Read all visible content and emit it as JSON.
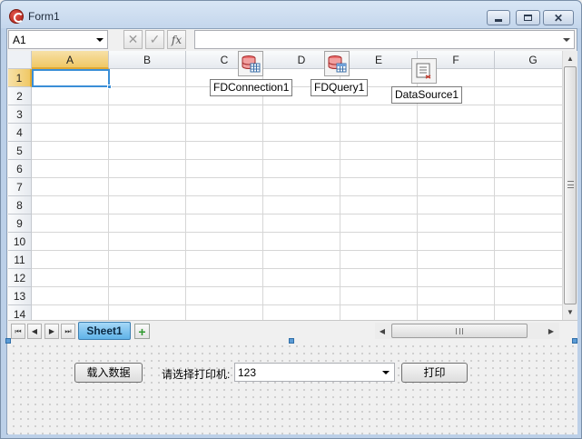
{
  "window": {
    "title": "Form1"
  },
  "formula_bar": {
    "cell_ref": "A1",
    "formula": ""
  },
  "grid": {
    "columns": [
      "A",
      "B",
      "C",
      "D",
      "E",
      "F",
      "G"
    ],
    "rows": [
      "1",
      "2",
      "3",
      "4",
      "5",
      "6",
      "7",
      "8",
      "9",
      "10",
      "11",
      "12",
      "13",
      "14"
    ],
    "active_column": "A",
    "active_row": "1"
  },
  "components": [
    {
      "label": "FDConnection1",
      "icon": "database-connection-icon"
    },
    {
      "label": "FDQuery1",
      "icon": "database-query-icon"
    },
    {
      "label": "DataSource1",
      "icon": "datasource-icon"
    }
  ],
  "sheets": {
    "tabs": [
      "Sheet1"
    ],
    "active": "Sheet1"
  },
  "form": {
    "load_button": "载入数据",
    "printer_label": "请选择打印机:",
    "printer_value": "123",
    "print_button": "打印"
  },
  "colors": {
    "accent": "#3a8ed7",
    "active_header": "#f0c865",
    "sheet_tab": "#5fb2e8"
  }
}
